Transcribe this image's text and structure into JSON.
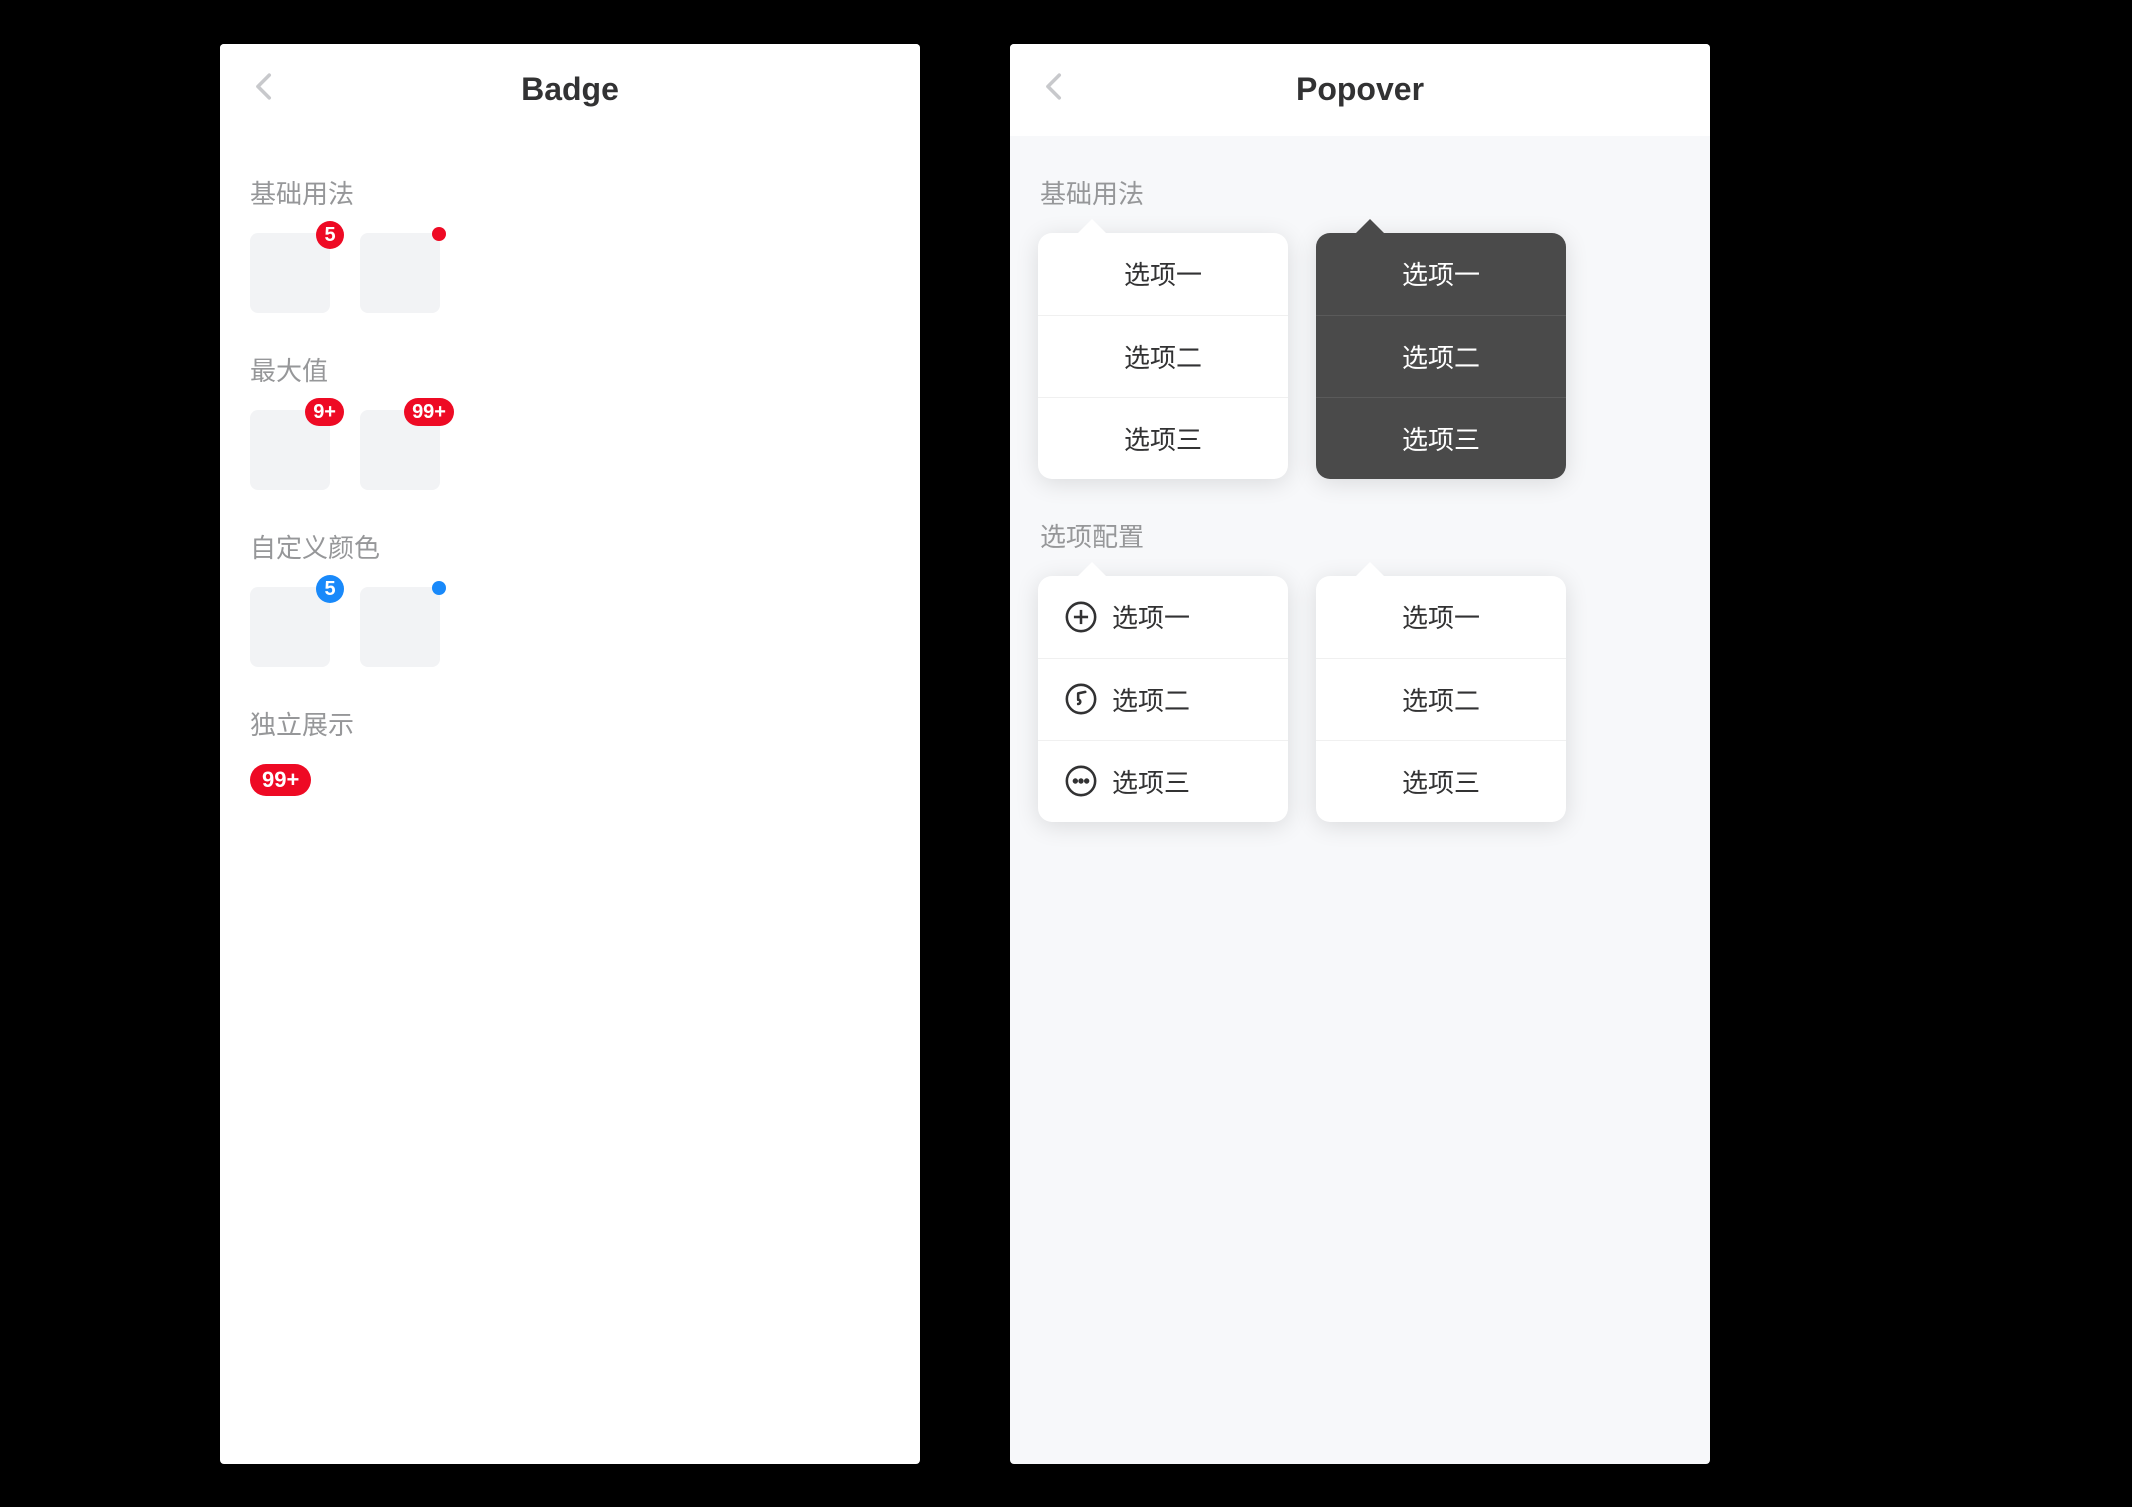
{
  "badge_screen": {
    "title": "Badge",
    "sections": {
      "basic": {
        "title": "基础用法",
        "items": {
          "count": "5"
        }
      },
      "max": {
        "title": "最大值",
        "items": {
          "nine_plus": "9+",
          "ninetynine_plus": "99+"
        }
      },
      "custom_color": {
        "title": "自定义颜色",
        "items": {
          "count": "5"
        }
      },
      "standalone": {
        "title": "独立展示",
        "value": "99+"
      }
    }
  },
  "popover_screen": {
    "title": "Popover",
    "sections": {
      "basic": {
        "title": "基础用法",
        "light": {
          "opt1": "选项一",
          "opt2": "选项二",
          "opt3": "选项三"
        },
        "dark": {
          "opt1": "选项一",
          "opt2": "选项二",
          "opt3": "选项三"
        }
      },
      "config": {
        "title": "选项配置",
        "icons": {
          "opt1": "选项一",
          "opt2": "选项二",
          "opt3": "选项三"
        },
        "disabled": {
          "opt1": "选项一",
          "opt2": "选项二",
          "opt3": "选项三"
        }
      }
    }
  },
  "colors": {
    "badge_red": "#ee0a24",
    "brand_blue": "#1989fa",
    "text_primary": "#323233",
    "text_secondary": "#969799",
    "popover_dark_bg": "#4a4a4a"
  }
}
